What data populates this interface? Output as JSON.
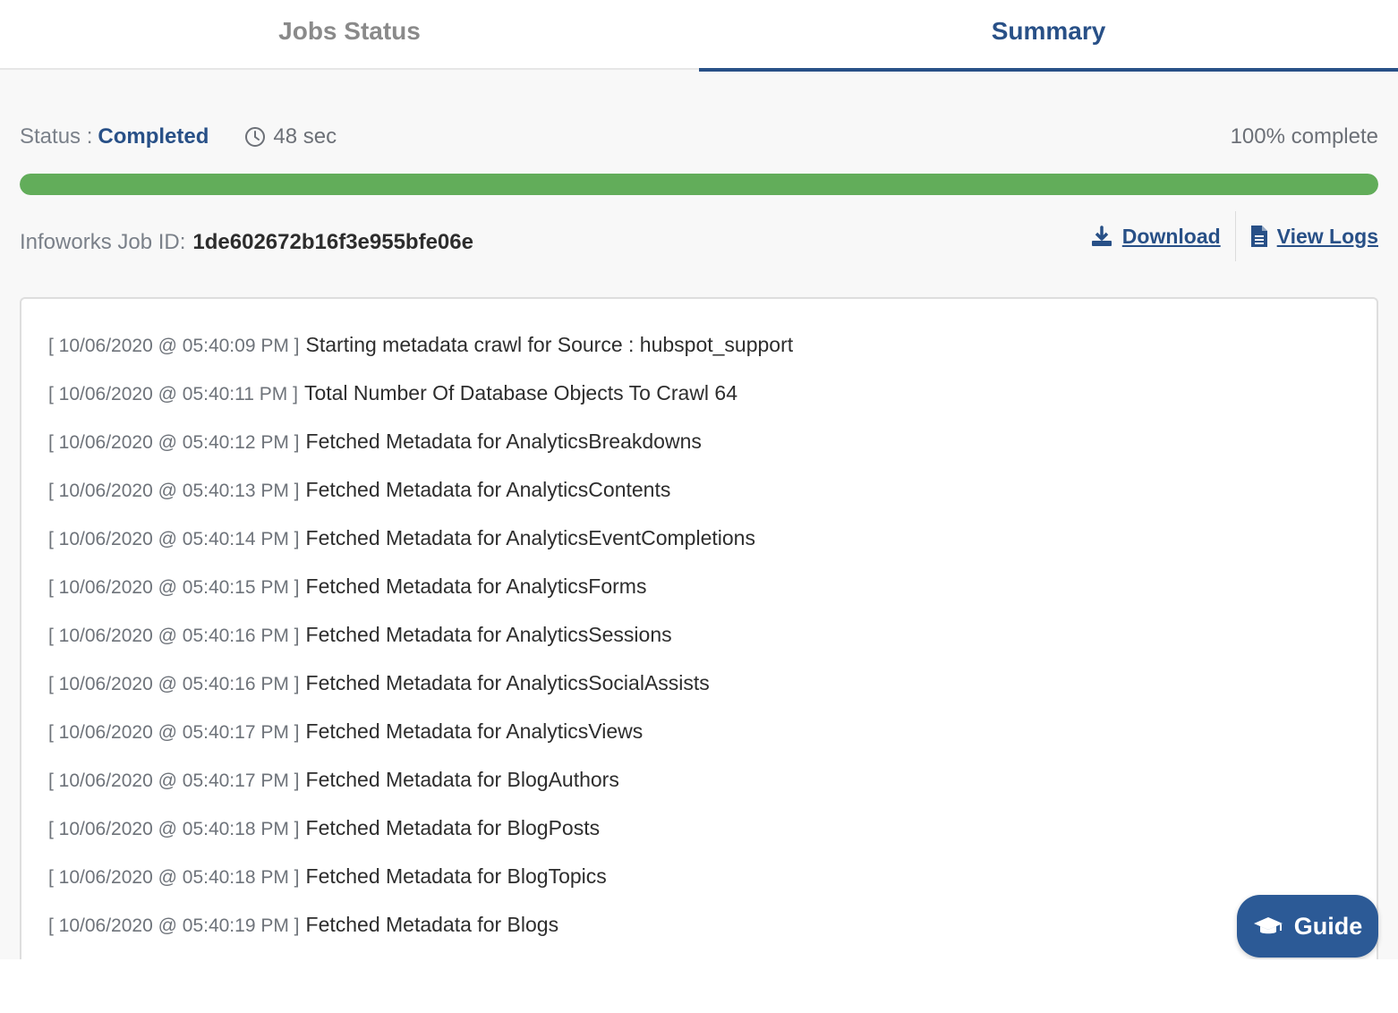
{
  "tabs": [
    {
      "label": "Jobs Status",
      "active": false
    },
    {
      "label": "Summary",
      "active": true
    }
  ],
  "status": {
    "label": "Status :",
    "value": "Completed",
    "duration": "48 sec",
    "percent_text": "100% complete",
    "progress_fraction": 1.0
  },
  "job": {
    "id_label": "Infoworks Job ID:",
    "id_value": "1de602672b16f3e955bfe06e"
  },
  "actions": {
    "download_label": "Download",
    "view_logs_label": "View Logs"
  },
  "log_lines": [
    {
      "ts": "[ 10/06/2020 @ 05:40:09 PM ]",
      "msg": "Starting metadata crawl for Source : hubspot_support"
    },
    {
      "ts": "[ 10/06/2020 @ 05:40:11 PM ]",
      "msg": "Total Number Of Database Objects To Crawl 64"
    },
    {
      "ts": "[ 10/06/2020 @ 05:40:12 PM ]",
      "msg": "Fetched Metadata for AnalyticsBreakdowns"
    },
    {
      "ts": "[ 10/06/2020 @ 05:40:13 PM ]",
      "msg": "Fetched Metadata for AnalyticsContents"
    },
    {
      "ts": "[ 10/06/2020 @ 05:40:14 PM ]",
      "msg": "Fetched Metadata for AnalyticsEventCompletions"
    },
    {
      "ts": "[ 10/06/2020 @ 05:40:15 PM ]",
      "msg": "Fetched Metadata for AnalyticsForms"
    },
    {
      "ts": "[ 10/06/2020 @ 05:40:16 PM ]",
      "msg": "Fetched Metadata for AnalyticsSessions"
    },
    {
      "ts": "[ 10/06/2020 @ 05:40:16 PM ]",
      "msg": "Fetched Metadata for AnalyticsSocialAssists"
    },
    {
      "ts": "[ 10/06/2020 @ 05:40:17 PM ]",
      "msg": "Fetched Metadata for AnalyticsViews"
    },
    {
      "ts": "[ 10/06/2020 @ 05:40:17 PM ]",
      "msg": "Fetched Metadata for BlogAuthors"
    },
    {
      "ts": "[ 10/06/2020 @ 05:40:18 PM ]",
      "msg": "Fetched Metadata for BlogPosts"
    },
    {
      "ts": "[ 10/06/2020 @ 05:40:18 PM ]",
      "msg": "Fetched Metadata for BlogTopics"
    },
    {
      "ts": "[ 10/06/2020 @ 05:40:19 PM ]",
      "msg": "Fetched Metadata for Blogs"
    }
  ],
  "guide": {
    "label": "Guide",
    "icon": "graduation-cap-icon"
  },
  "icons": {
    "duration": "clock-icon",
    "download": "download-icon",
    "view_logs": "document-icon"
  },
  "colors": {
    "accent": "#285087",
    "progress": "#62ad5a",
    "guide": "#2c5a96"
  }
}
